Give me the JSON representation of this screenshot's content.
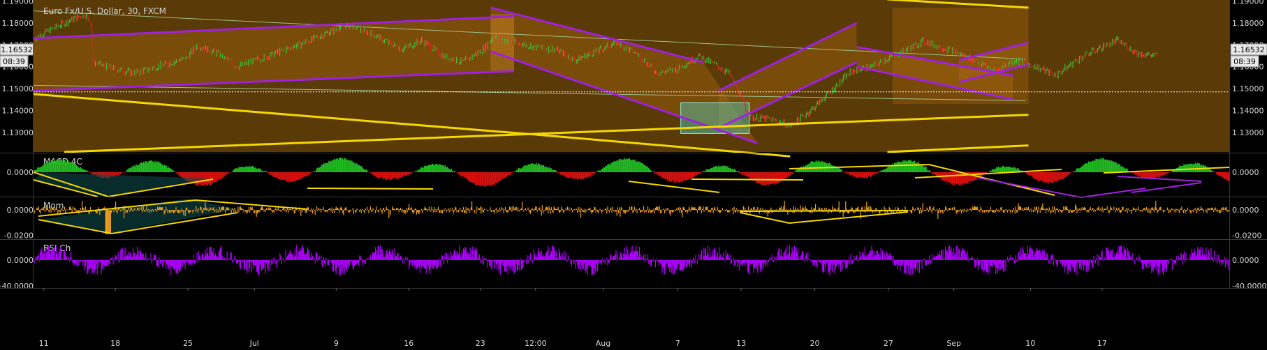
{
  "symbol_title": "Euro Fx/U.S. Dollar, 30, FXCM",
  "last_price": "1.16532",
  "countdown": "08:39",
  "colors": {
    "panel_bg": "#5a3a06",
    "channel": "#a020e0",
    "trendline": "#f5d800",
    "thin_line": "#9fbf8a",
    "box": "#4fd0c0",
    "macd_up": "#22c022",
    "macd_down": "#e01010",
    "mom": "#f0a020",
    "rsi": "#b000ff"
  },
  "x_axis": {
    "ticks": [
      {
        "label": "11",
        "t": 0.01
      },
      {
        "label": "18",
        "t": 0.08
      },
      {
        "label": "25",
        "t": 0.151
      },
      {
        "label": "Jul",
        "t": 0.216
      },
      {
        "label": "9",
        "t": 0.296
      },
      {
        "label": "16",
        "t": 0.367
      },
      {
        "label": "23",
        "t": 0.437
      },
      {
        "label": "12:00",
        "t": 0.491
      },
      {
        "label": "Aug",
        "t": 0.557
      },
      {
        "label": "7",
        "t": 0.63
      },
      {
        "label": "13",
        "t": 0.692
      },
      {
        "label": "20",
        "t": 0.764
      },
      {
        "label": "27",
        "t": 0.836
      },
      {
        "label": "Sep",
        "t": 0.9
      },
      {
        "label": "10",
        "t": 0.975
      },
      {
        "label": "17",
        "t": 1.045
      }
    ]
  },
  "chart_data": [
    {
      "type": "candlestick",
      "title": "Euro Fx/U.S. Dollar, 30, FXCM",
      "ylim": [
        1.121,
        1.1905
      ],
      "y_ticks": [
        "1.19000",
        "1.18000",
        "1.17000",
        "1.16000",
        "1.15000",
        "1.14000",
        "1.13000"
      ],
      "y_tick_values": [
        1.19,
        1.18,
        1.17,
        1.16,
        1.15,
        1.14,
        1.13
      ],
      "price_path": [
        [
          0.0,
          1.173
        ],
        [
          0.03,
          1.18
        ],
        [
          0.05,
          1.184
        ],
        [
          0.056,
          1.181
        ],
        [
          0.058,
          1.162
        ],
        [
          0.07,
          1.16
        ],
        [
          0.1,
          1.157
        ],
        [
          0.12,
          1.16
        ],
        [
          0.15,
          1.164
        ],
        [
          0.16,
          1.17
        ],
        [
          0.18,
          1.166
        ],
        [
          0.2,
          1.16
        ],
        [
          0.23,
          1.165
        ],
        [
          0.27,
          1.172
        ],
        [
          0.3,
          1.178
        ],
        [
          0.31,
          1.179
        ],
        [
          0.33,
          1.175
        ],
        [
          0.36,
          1.168
        ],
        [
          0.38,
          1.172
        ],
        [
          0.4,
          1.165
        ],
        [
          0.42,
          1.162
        ],
        [
          0.44,
          1.168
        ],
        [
          0.45,
          1.174
        ],
        [
          0.47,
          1.171
        ],
        [
          0.49,
          1.169
        ],
        [
          0.51,
          1.168
        ],
        [
          0.53,
          1.163
        ],
        [
          0.55,
          1.167
        ],
        [
          0.57,
          1.171
        ],
        [
          0.59,
          1.166
        ],
        [
          0.61,
          1.157
        ],
        [
          0.63,
          1.159
        ],
        [
          0.65,
          1.165
        ],
        [
          0.67,
          1.16
        ],
        [
          0.68,
          1.157
        ],
        [
          0.692,
          1.146
        ],
        [
          0.7,
          1.137
        ],
        [
          0.72,
          1.136
        ],
        [
          0.74,
          1.133
        ],
        [
          0.76,
          1.14
        ],
        [
          0.78,
          1.149
        ],
        [
          0.8,
          1.158
        ],
        [
          0.82,
          1.16
        ],
        [
          0.84,
          1.165
        ],
        [
          0.86,
          1.169
        ],
        [
          0.87,
          1.172
        ],
        [
          0.88,
          1.17
        ],
        [
          0.9,
          1.167
        ],
        [
          0.92,
          1.163
        ],
        [
          0.94,
          1.158
        ],
        [
          0.96,
          1.163
        ],
        [
          0.98,
          1.16
        ],
        [
          1.0,
          1.156
        ],
        [
          1.02,
          1.163
        ],
        [
          1.04,
          1.168
        ],
        [
          1.06,
          1.172
        ],
        [
          1.08,
          1.166
        ],
        [
          1.1,
          1.165
        ]
      ],
      "purple_channels": [
        [
          [
            0.0,
            1.173
          ],
          [
            0.47,
            1.183
          ]
        ],
        [
          [
            0.0,
            1.149
          ],
          [
            0.47,
            1.158
          ]
        ],
        [
          [
            0.447,
            1.187
          ],
          [
            0.655,
            1.162
          ]
        ],
        [
          [
            0.447,
            1.167
          ],
          [
            0.708,
            1.125
          ]
        ],
        [
          [
            0.67,
            1.149
          ],
          [
            0.805,
            1.18
          ]
        ],
        [
          [
            0.67,
            1.132
          ],
          [
            0.805,
            1.162
          ]
        ],
        [
          [
            0.805,
            1.169
          ],
          [
            0.958,
            1.156
          ]
        ],
        [
          [
            0.805,
            1.16
          ],
          [
            0.958,
            1.145
          ]
        ],
        [
          [
            0.905,
            1.163
          ],
          [
            0.973,
            1.171
          ]
        ],
        [
          [
            0.905,
            1.153
          ],
          [
            0.973,
            1.161
          ]
        ]
      ],
      "yellow_lines": [
        [
          [
            0.0,
            1.1475
          ],
          [
            0.49,
            1.129
          ]
        ],
        [
          [
            0.49,
            1.129
          ],
          [
            0.74,
            1.119
          ]
        ],
        [
          [
            0.03,
            1.121
          ],
          [
            0.973,
            1.138
          ]
        ],
        [
          [
            0.835,
            1.1908
          ],
          [
            0.973,
            1.187
          ]
        ],
        [
          [
            0.835,
            1.121
          ],
          [
            0.973,
            1.124
          ]
        ]
      ],
      "thin_lines": [
        [
          [
            0.0,
            1.1855
          ],
          [
            0.97,
            1.1635
          ]
        ],
        [
          [
            0.0,
            1.1515
          ],
          [
            0.97,
            1.1445
          ]
        ]
      ],
      "dotted_level": 1.1485,
      "box": {
        "x0": 0.633,
        "x1": 0.7,
        "y0": 1.1295,
        "y1": 1.1435
      }
    },
    {
      "type": "histogram",
      "title": "MACD 4C",
      "y_ticks": [
        "0.0000"
      ],
      "ylim": [
        -1,
        1
      ]
    },
    {
      "type": "histogram",
      "title": "Mom",
      "y_ticks": [
        "0.0000",
        "-0.0200"
      ],
      "ylim": [
        -0.0225,
        0.0095
      ]
    },
    {
      "type": "histogram",
      "title": "RSI Ch",
      "y_ticks": [
        "0.0000",
        "-40.0000"
      ],
      "ylim": [
        -42,
        30
      ]
    }
  ]
}
